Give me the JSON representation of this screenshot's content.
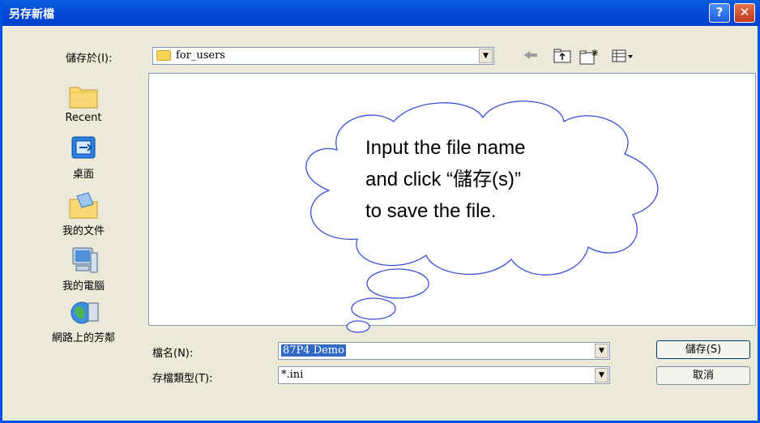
{
  "window": {
    "title": "另存新檔",
    "help_glyph": "?",
    "close_glyph": "✕"
  },
  "toolbar": {
    "save_in_label": "儲存於(I):",
    "save_in_value": "for_users",
    "icons": [
      "back-arrow-icon",
      "up-folder-icon",
      "new-folder-icon",
      "view-menu-icon"
    ]
  },
  "places": [
    {
      "label": "Recent",
      "icon": "recent-folder-icon"
    },
    {
      "label": "桌面",
      "icon": "desktop-icon"
    },
    {
      "label": "我的文件",
      "icon": "my-documents-icon"
    },
    {
      "label": "我的電腦",
      "icon": "my-computer-icon"
    },
    {
      "label": "網路上的芳鄰",
      "icon": "network-places-icon"
    }
  ],
  "callout": {
    "lines": [
      "Input the file name",
      "and click “儲存(s)”",
      "to save the file."
    ]
  },
  "form": {
    "filename_label": "檔名(N):",
    "filename_value": "87P4 Demo",
    "filetype_label": "存檔類型(T):",
    "filetype_value": "*.ini"
  },
  "buttons": {
    "save": "儲存(S)",
    "cancel": "取消"
  },
  "colors": {
    "titlebar": "#0347d4",
    "dialog_bg": "#ece9d8",
    "selection": "#316ac5",
    "cloud_stroke": "#3a4fd9"
  }
}
